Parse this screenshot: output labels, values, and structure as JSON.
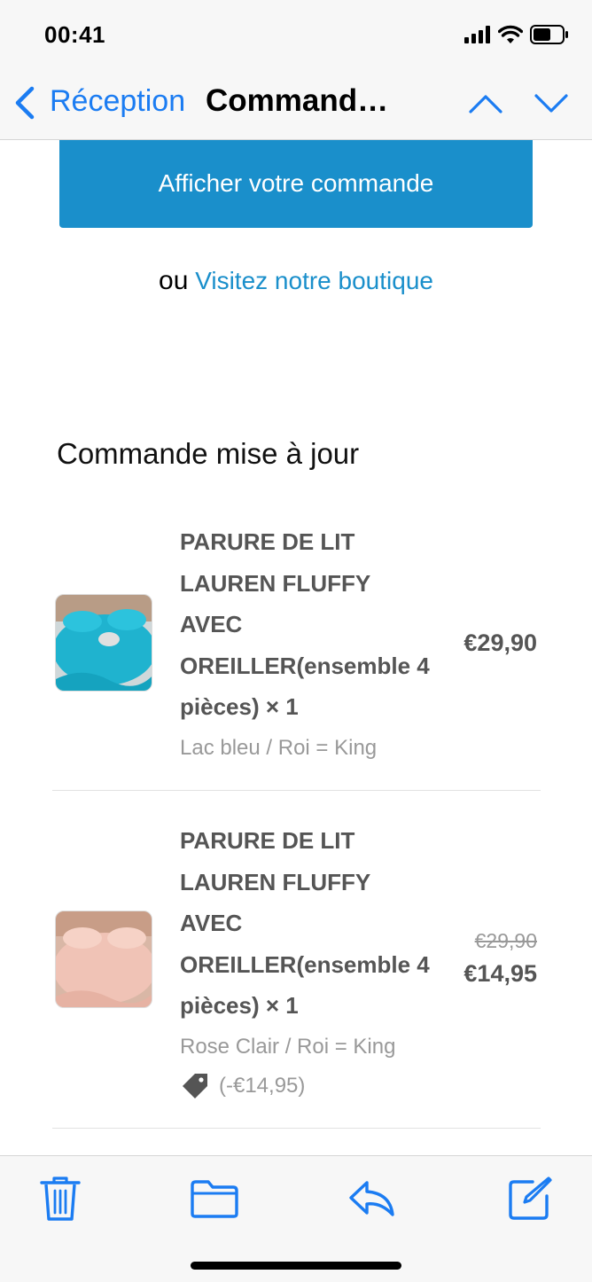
{
  "status_bar": {
    "time": "00:41"
  },
  "nav": {
    "back_label": "Réception",
    "title": "Command…"
  },
  "email": {
    "order_button_label": "Afficher votre commande",
    "or_text": "ou",
    "shop_link_label": "Visitez notre boutique",
    "section_title": "Commande mise à jour"
  },
  "items": [
    {
      "name": "PARURE DE LIT LAUREN FLUFFY AVEC OREILLER(ensemble 4 pièces) × 1",
      "variant": "Lac bleu / Roi = King",
      "price": "€29,90",
      "thumb_color": "#1fb3cf"
    },
    {
      "name": "PARURE DE LIT LAUREN FLUFFY AVEC OREILLER(ensemble 4 pièces) × 1",
      "variant": "Rose Clair / Roi = King",
      "old_price": "€29,90",
      "price": "€14,95",
      "discount": "(-€14,95)",
      "thumb_color": "#f0c3b6"
    }
  ],
  "toolbar": {
    "icons": [
      "trash-icon",
      "folder-icon",
      "reply-icon",
      "compose-icon"
    ]
  },
  "colors": {
    "accent": "#1b7cf2",
    "button": "#1a8fcb",
    "text_gray": "#555555",
    "muted": "#999999"
  }
}
